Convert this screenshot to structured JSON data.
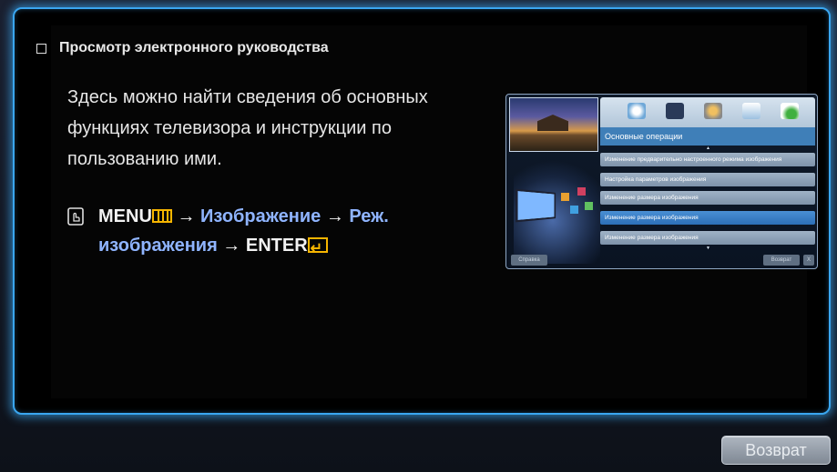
{
  "heading": "Просмотр электронного руководства",
  "description": "Здесь можно найти сведения об основных функциях телевизора и инструкции по пользованию ими.",
  "path": {
    "menu": "MENU",
    "arrow": "→",
    "step1": "Изображение",
    "step2a": "Реж.",
    "step2b": "изображения",
    "enter": "ENTER"
  },
  "thumbnail": {
    "title": "Основные операции",
    "items": [
      "Изменение предварительно настроенного режима изображения",
      "Настройка параметров изображения",
      "Изменение размера изображения",
      "Изменение размера изображения",
      "Изменение размера изображения"
    ],
    "selected_index": 3,
    "btn_left": "Справка",
    "btn_right": "Возврат",
    "btn_close": "X"
  },
  "footer": {
    "return_label": "Возврат"
  },
  "colors": {
    "glow": "#3aa6f0",
    "highlight_text": "#8fb4ff",
    "menu_icon": "#f7b500"
  }
}
